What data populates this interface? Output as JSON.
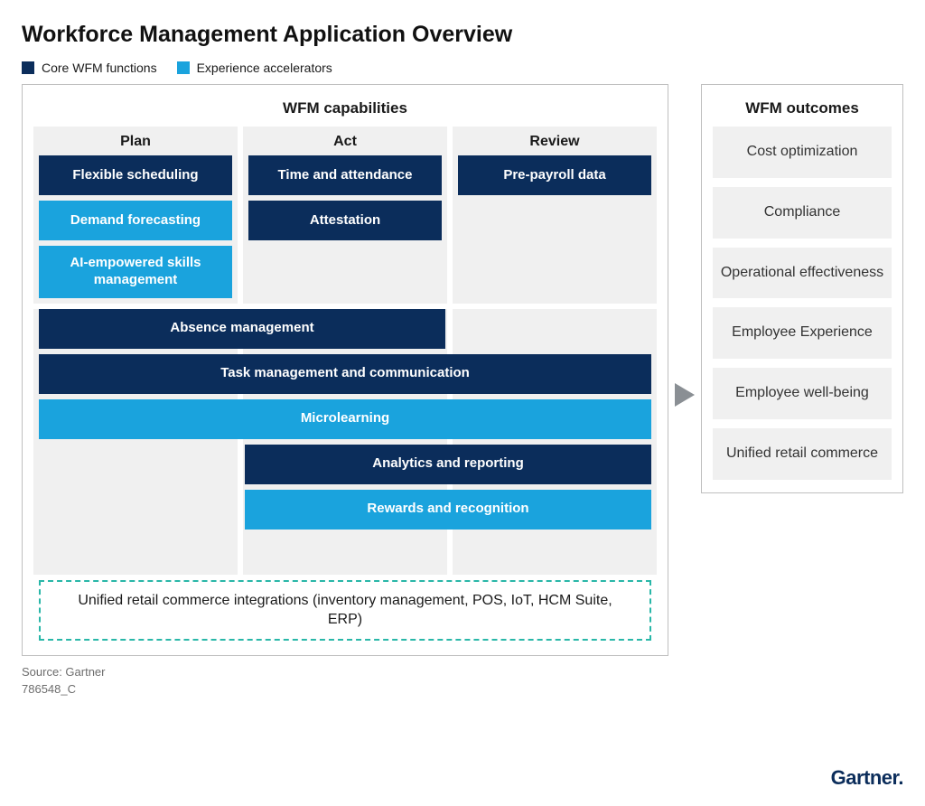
{
  "title": "Workforce Management Application Overview",
  "legend": {
    "core": "Core WFM functions",
    "accel": "Experience accelerators"
  },
  "colors": {
    "core": "#0b2d5b",
    "accel": "#1aa3dd",
    "panel_border": "#bfbfbf",
    "col_bg": "#f0f0f0",
    "dashed": "#29b7a8"
  },
  "capabilities": {
    "header": "WFM capabilities",
    "columns": [
      "Plan",
      "Act",
      "Review"
    ],
    "plan": [
      {
        "label": "Flexible scheduling",
        "kind": "core"
      },
      {
        "label": "Demand forecasting",
        "kind": "accel"
      },
      {
        "label": "AI-empowered skills management",
        "kind": "accel"
      }
    ],
    "act": [
      {
        "label": "Time and attendance",
        "kind": "core"
      },
      {
        "label": "Attestation",
        "kind": "core"
      }
    ],
    "review": [
      {
        "label": "Pre-payroll data",
        "kind": "core"
      }
    ],
    "spanning": [
      {
        "label": "Absence management",
        "kind": "core",
        "start": 1,
        "span": 2
      },
      {
        "label": "Task management and communication",
        "kind": "core",
        "start": 1,
        "span": 3
      },
      {
        "label": "Microlearning",
        "kind": "accel",
        "start": 1,
        "span": 3
      },
      {
        "label": "Analytics and reporting",
        "kind": "core",
        "start": 2,
        "span": 2
      },
      {
        "label": "Rewards and recognition",
        "kind": "accel",
        "start": 2,
        "span": 2
      }
    ],
    "unified": "Unified retail commerce integrations  (inventory management, POS, IoT, HCM Suite, ERP)"
  },
  "outcomes": {
    "header": "WFM outcomes",
    "items": [
      "Cost optimization",
      "Compliance",
      "Operational effectiveness",
      "Employee Experience",
      "Employee well-being",
      "Unified retail commerce"
    ]
  },
  "source": "Source: Gartner",
  "figure_id": "786548_C",
  "brand": "Gartner"
}
